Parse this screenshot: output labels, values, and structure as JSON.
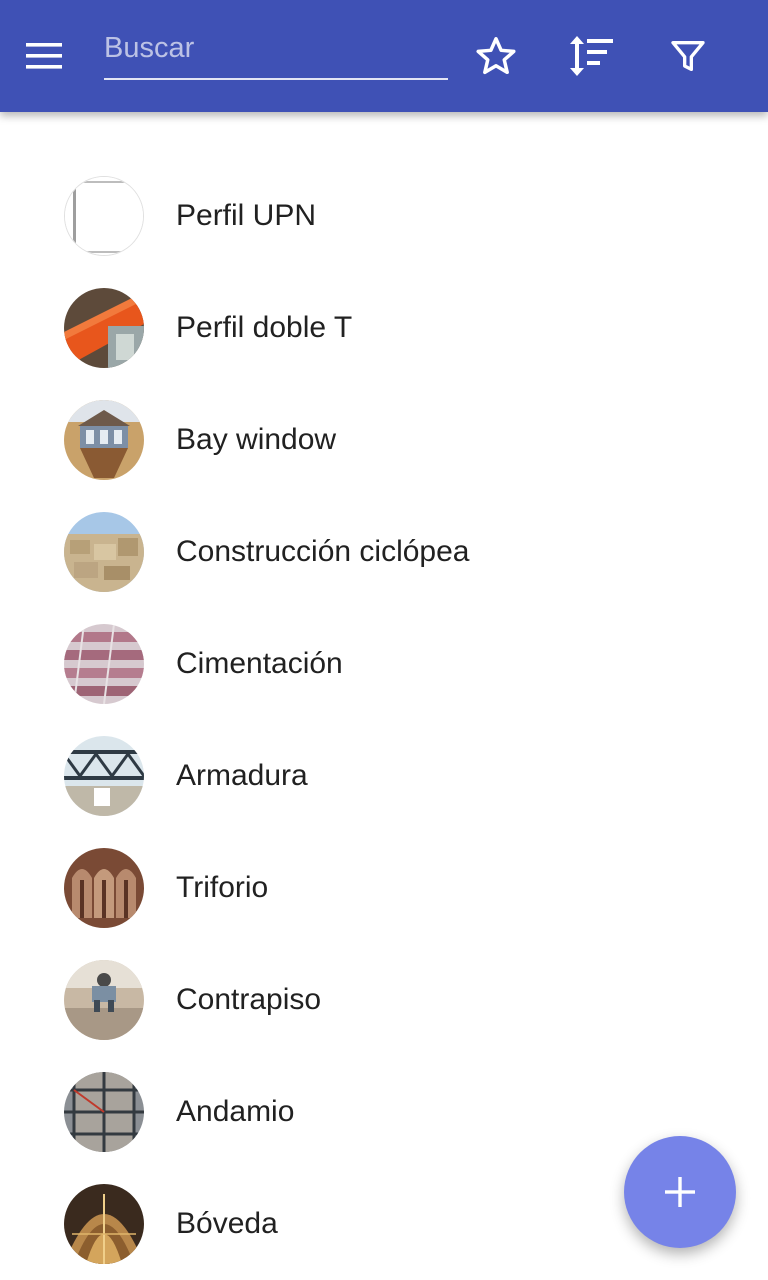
{
  "toolbar": {
    "background": "#3f51b5",
    "menu_icon": "menu-icon",
    "search": {
      "placeholder": "Buscar",
      "value": ""
    },
    "actions": [
      {
        "icon": "star-outline-icon"
      },
      {
        "icon": "sort-icon"
      },
      {
        "icon": "filter-icon"
      }
    ]
  },
  "list": {
    "items": [
      {
        "label": "Perfil UPN",
        "thumbnail": "photo-perfil-upn"
      },
      {
        "label": "Perfil doble T",
        "thumbnail": "photo-perfil-doble-t"
      },
      {
        "label": "Bay window",
        "thumbnail": "photo-bay-window"
      },
      {
        "label": "Construcción ciclópea",
        "thumbnail": "photo-construccion-ciclopea"
      },
      {
        "label": "Cimentación",
        "thumbnail": "photo-cimentacion"
      },
      {
        "label": "Armadura",
        "thumbnail": "photo-armadura"
      },
      {
        "label": "Triforio",
        "thumbnail": "photo-triforio"
      },
      {
        "label": "Contrapiso",
        "thumbnail": "photo-contrapiso"
      },
      {
        "label": "Andamio",
        "thumbnail": "photo-andamio"
      },
      {
        "label": "Bóveda",
        "thumbnail": "photo-boveda"
      }
    ]
  },
  "fab": {
    "icon": "plus-icon",
    "color": "#7683e8"
  }
}
